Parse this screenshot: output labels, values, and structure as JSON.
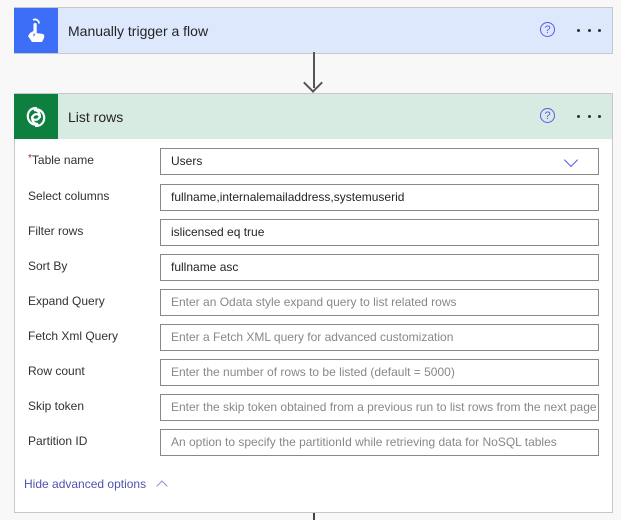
{
  "trigger_card": {
    "title": "Manually trigger a flow",
    "icon": "touch-hand-icon",
    "accent_color": "#3c6ef8",
    "help_glyph": "?"
  },
  "list_rows_card": {
    "title": "List rows",
    "icon": "dataverse-icon",
    "accent_color": "#0d8040",
    "help_glyph": "?",
    "fields": [
      {
        "label": "Table name",
        "required": true,
        "required_marker": "*",
        "value": "Users",
        "type": "dropdown"
      },
      {
        "label": "Select columns",
        "value": "fullname,internalemailaddress,systemuserid"
      },
      {
        "label": "Filter rows",
        "value": "islicensed eq true"
      },
      {
        "label": "Sort By",
        "value": "fullname asc"
      },
      {
        "label": "Expand Query",
        "placeholder": "Enter an Odata style expand query to list related rows"
      },
      {
        "label": "Fetch Xml Query",
        "placeholder": "Enter a Fetch XML query for advanced customization"
      },
      {
        "label": "Row count",
        "placeholder": "Enter the number of rows to be listed (default = 5000)"
      },
      {
        "label": "Skip token",
        "placeholder": "Enter the skip token obtained from a previous run to list rows from the next page"
      },
      {
        "label": "Partition ID",
        "placeholder": "An option to specify the partitionId while retrieving data for NoSQL tables"
      }
    ],
    "advanced_toggle_label": "Hide advanced options"
  }
}
